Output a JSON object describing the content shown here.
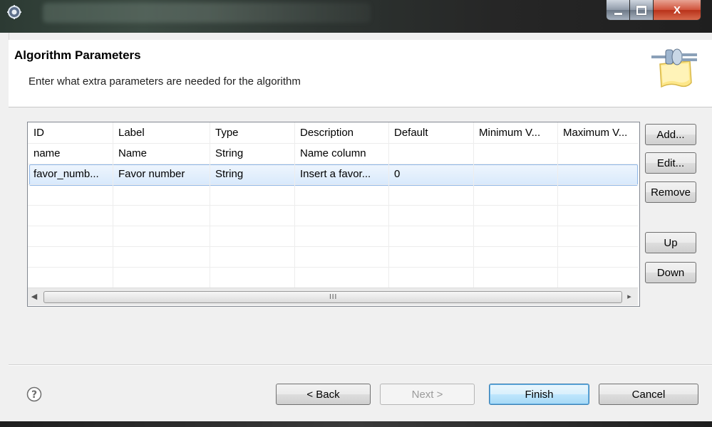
{
  "window": {
    "title": "",
    "controls": [
      "minimize-icon",
      "maximize-icon",
      "close-icon"
    ],
    "close_label": "X"
  },
  "header": {
    "title": "Algorithm Parameters",
    "description": "Enter what extra parameters are needed for the algorithm"
  },
  "table": {
    "columns": [
      "ID",
      "Label",
      "Type",
      "Description",
      "Default",
      "Minimum V...",
      "Maximum V..."
    ],
    "rows": [
      [
        "name",
        "Name",
        "String",
        "Name column",
        "",
        "",
        ""
      ],
      [
        "favor_numb...",
        "Favor number",
        "String",
        "Insert a favor...",
        "0",
        "",
        ""
      ]
    ],
    "selected_row": 1,
    "scroll_grip": "III"
  },
  "side_buttons": {
    "add": "Add...",
    "edit": "Edit...",
    "remove": "Remove",
    "up": "Up",
    "down": "Down"
  },
  "footer": {
    "help_icon": "question-icon",
    "back": "< Back",
    "next": "Next >",
    "finish": "Finish",
    "cancel": "Cancel"
  },
  "colors": {
    "selection": "#d8e9fc",
    "default_button": "#a7d9f5",
    "close_button": "#c9432a"
  }
}
